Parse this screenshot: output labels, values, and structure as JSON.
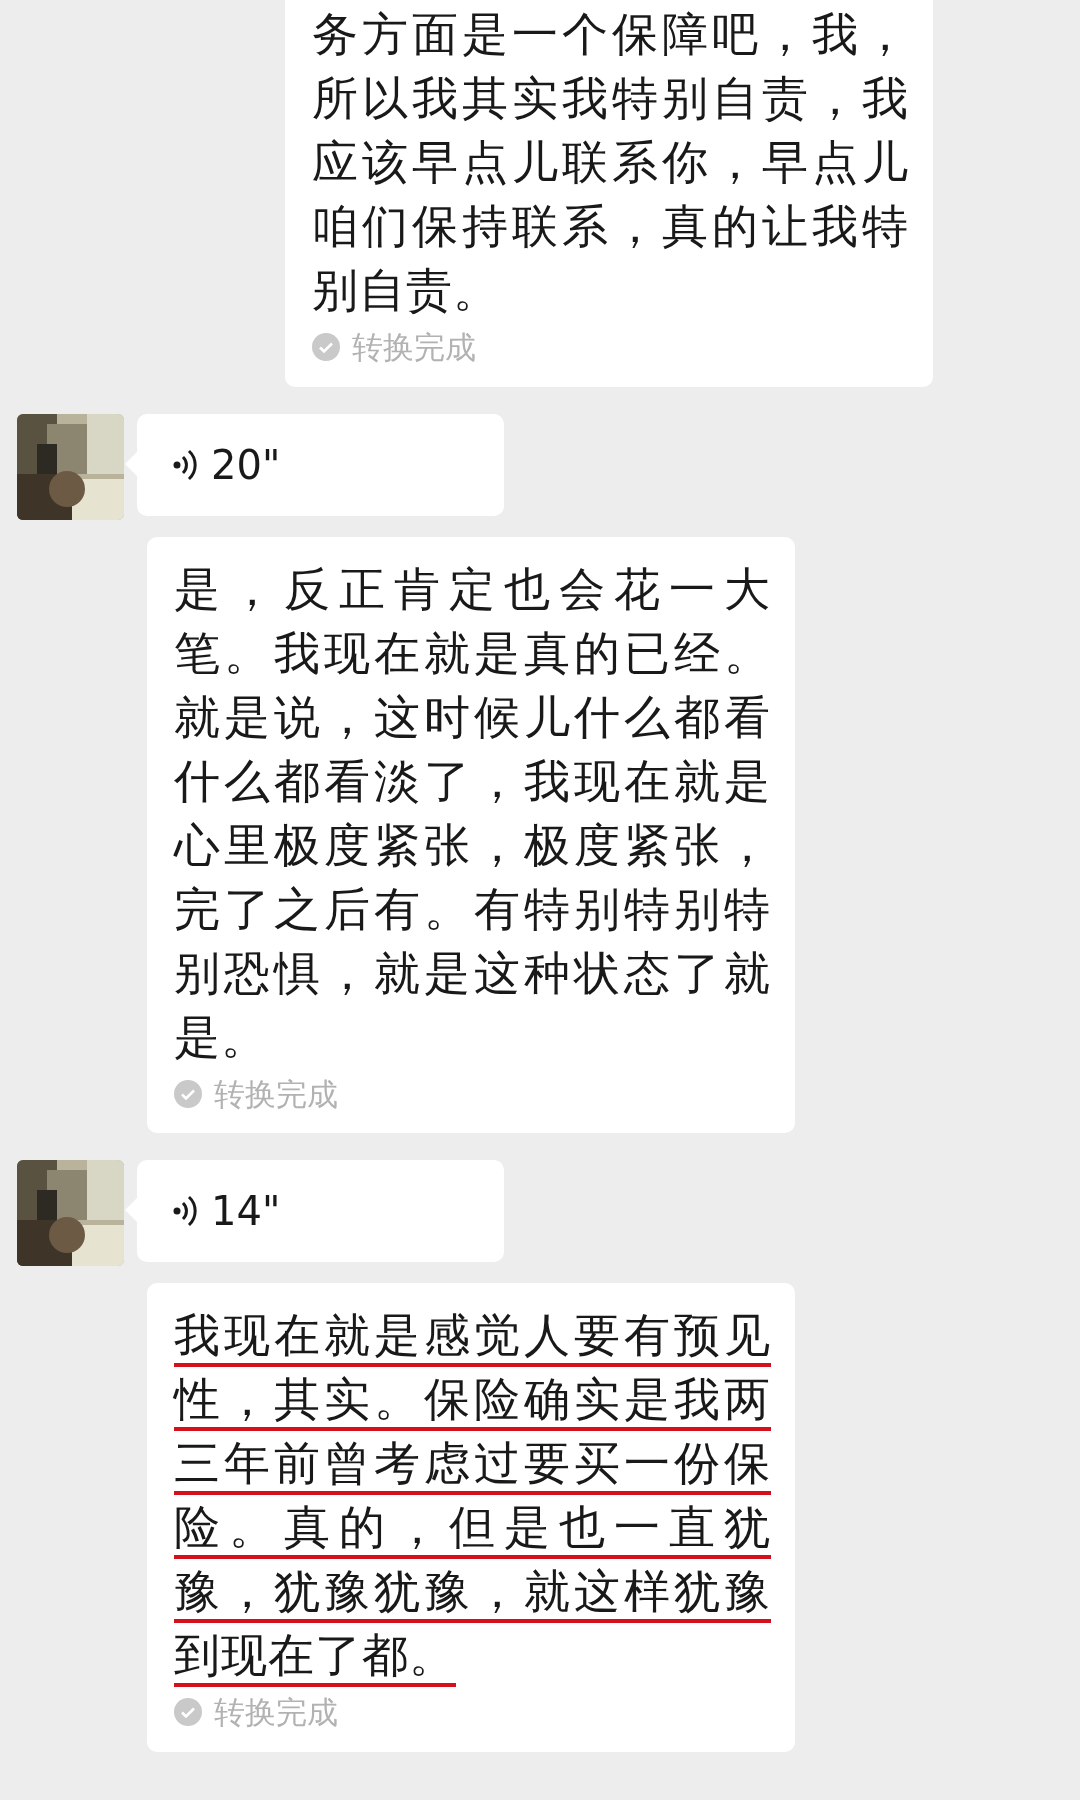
{
  "messages": [
    {
      "kind": "outgoing_transcript",
      "text": "务方面是一个保障吧，我，所以我其实我特别自责，我应该早点儿联系你，早点儿咱们保持联系，真的让我特别自责。",
      "status": "转换完成",
      "underlined": false
    },
    {
      "kind": "voice",
      "duration": "20\""
    },
    {
      "kind": "transcript",
      "text": "是，反正肯定也会花一大笔。我现在就是真的已经。就是说，这时候儿什么都看什么都看淡了，我现在就是心里极度紧张，极度紧张，完了之后有。有特别特别特别恐惧，就是这种状态了就是。",
      "status": "转换完成",
      "underlined": false
    },
    {
      "kind": "voice",
      "duration": "14\""
    },
    {
      "kind": "transcript",
      "text": "我现在就是感觉人要有预见性，其实。保险确实是我两三年前曾考虑过要买一份保险。真的，但是也一直犹豫，犹豫犹豫，就这样犹豫到现在了都。",
      "status": "转换完成",
      "underlined": true
    }
  ]
}
